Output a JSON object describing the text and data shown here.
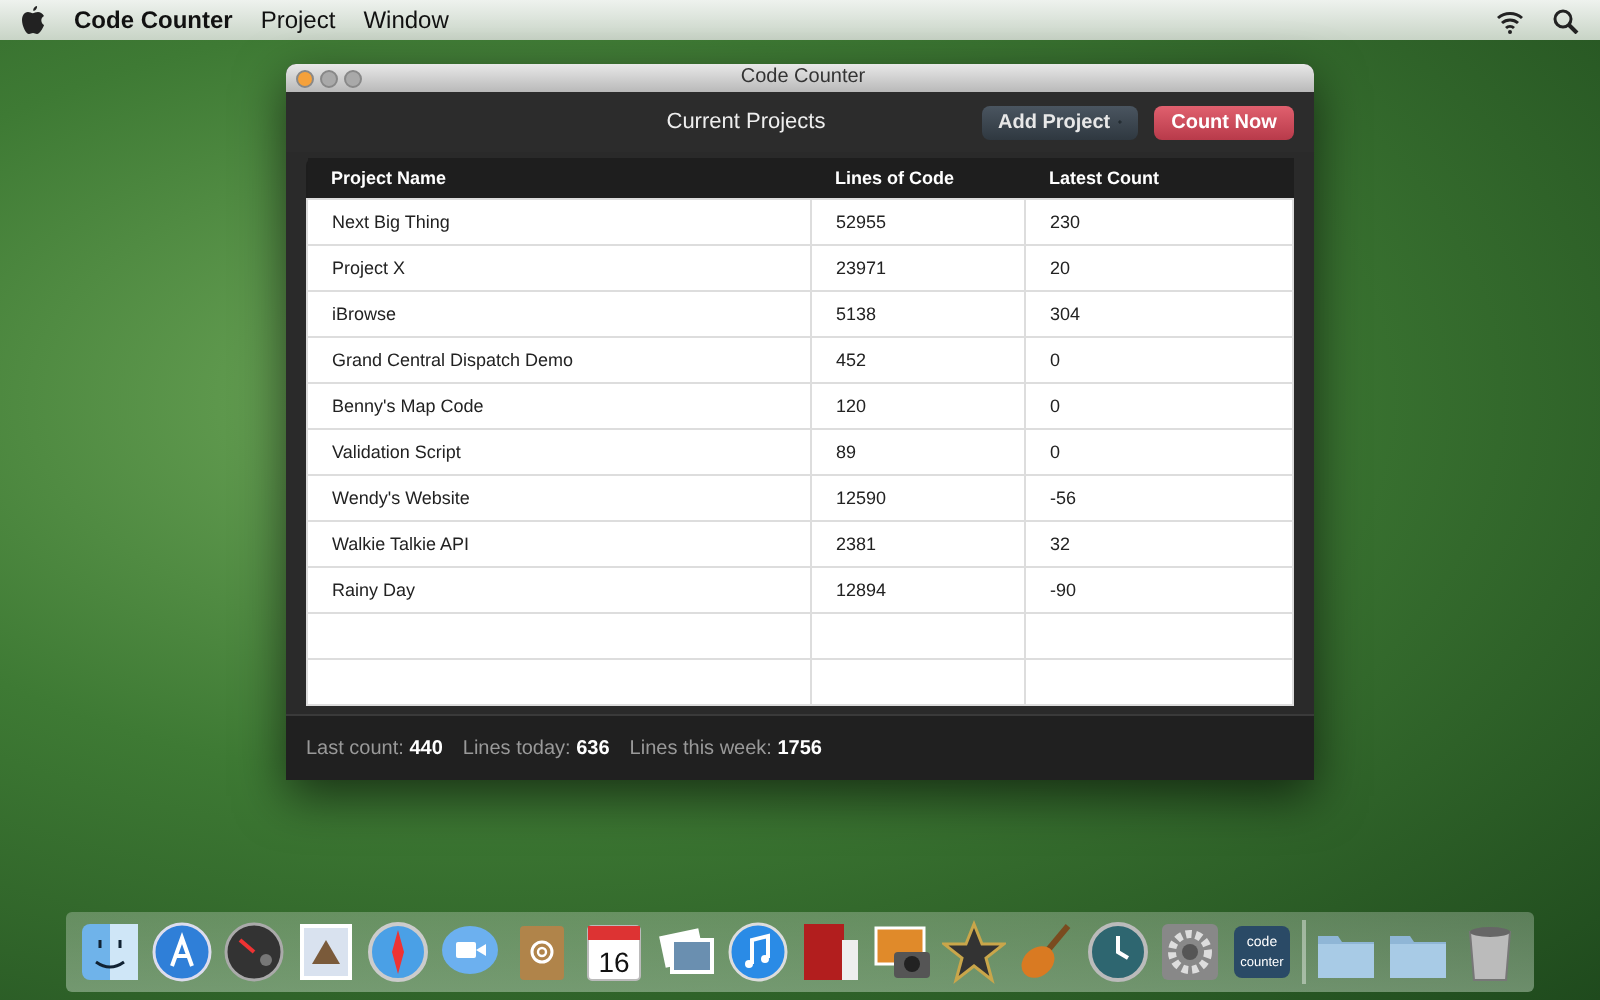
{
  "menu_bar": {
    "app_name": "Code Counter",
    "items": [
      "Project",
      "Window"
    ]
  },
  "window": {
    "title": "Code Counter",
    "heading": "Current Projects",
    "buttons": [
      {
        "label": "Add Project",
        "kind": "add"
      },
      {
        "label": "Count Now",
        "kind": "primary"
      }
    ]
  },
  "table": {
    "columns": [
      "Project Name",
      "Lines of Code",
      "Latest Count"
    ],
    "rows": [
      [
        "Next Big Thing",
        "52955",
        "230"
      ],
      [
        "Project X",
        "23971",
        "20"
      ],
      [
        "iBrowse",
        "5138",
        "304"
      ],
      [
        "Grand Central Dispatch Demo",
        "452",
        "0"
      ],
      [
        "Benny's Map Code",
        "120",
        "0"
      ],
      [
        "Validation Script",
        "89",
        "0"
      ],
      [
        "Wendy's Website",
        "12590",
        "-56"
      ],
      [
        "Walkie Talkie API",
        "2381",
        "32"
      ],
      [
        "Rainy Day",
        "12894",
        "-90"
      ]
    ]
  },
  "status_bar": [
    {
      "label": "Last count:",
      "value": "440"
    },
    {
      "label": "Lines today:",
      "value": "636"
    },
    {
      "label": "Lines this week:",
      "value": "1756"
    }
  ],
  "dock": [
    {
      "kind": "finder"
    },
    {
      "kind": "store"
    },
    {
      "kind": "gauge"
    },
    {
      "kind": "stamp"
    },
    {
      "kind": "compass"
    },
    {
      "kind": "video"
    },
    {
      "kind": "book"
    },
    {
      "kind": "calendar",
      "text": "16"
    },
    {
      "kind": "photos"
    },
    {
      "kind": "music"
    },
    {
      "kind": "curtain"
    },
    {
      "kind": "camera"
    },
    {
      "kind": "star"
    },
    {
      "kind": "guitar"
    },
    {
      "kind": "clock"
    },
    {
      "kind": "gear"
    },
    {
      "kind": "app",
      "text": "code counter"
    },
    {
      "kind": "separator"
    },
    {
      "kind": "folder"
    },
    {
      "kind": "folder"
    },
    {
      "kind": "trash"
    }
  ]
}
